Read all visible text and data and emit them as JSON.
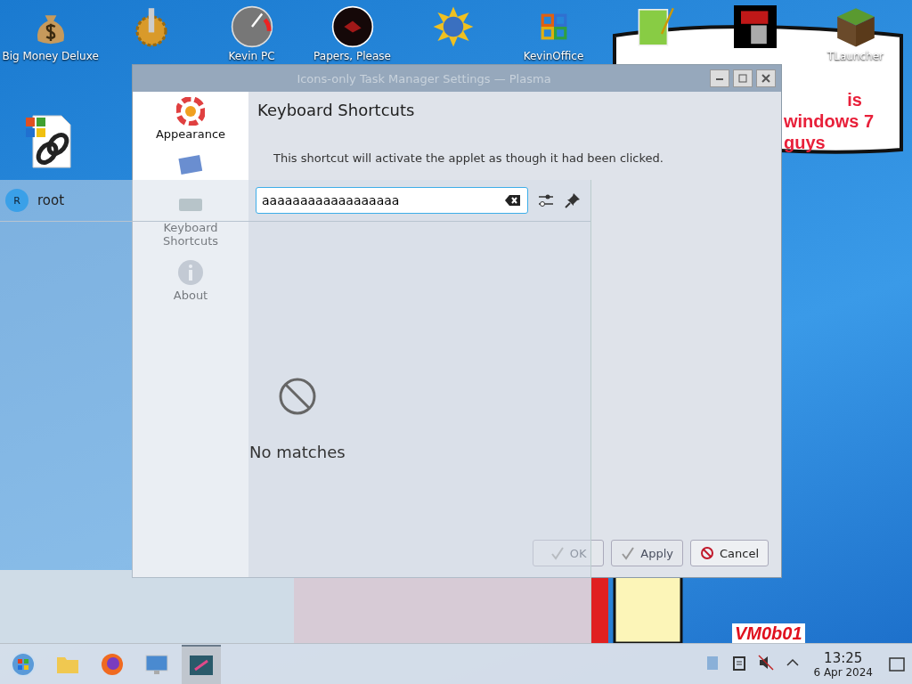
{
  "desktop": {
    "icons": [
      {
        "kind": "money",
        "label": "Big Money Deluxe"
      },
      {
        "kind": "gear"
      },
      {
        "kind": "gauge",
        "label": "Kevin PC"
      },
      {
        "kind": "disc",
        "label": "Papers, Please"
      },
      {
        "kind": "globe"
      },
      {
        "kind": "office",
        "label": "KevinOffice"
      },
      {
        "kind": "notepad"
      },
      {
        "kind": "mp"
      },
      {
        "kind": "cube",
        "label": "TLauncher"
      }
    ],
    "second_row": [
      {
        "kind": "shortcut"
      }
    ],
    "sticker": {
      "lines": [
        "is",
        "windows 7 guys"
      ]
    },
    "corner_text": "VM0b01"
  },
  "window": {
    "title": "Icons-only Task Manager Settings — Plasma",
    "sidebar": [
      {
        "kind": "appearance",
        "label": "Appearance"
      },
      {
        "kind": "behavior"
      },
      {
        "kind": "keyboard",
        "label": "Keyboard Shortcuts"
      },
      {
        "kind": "about",
        "label": "About"
      }
    ],
    "heading": "Keyboard Shortcuts",
    "description": "This shortcut will activate the applet as though it had been clicked.",
    "buttons": [
      {
        "kind": "ok",
        "label": "OK",
        "disabled": true
      },
      {
        "kind": "ok",
        "label": "Apply",
        "disabled": true
      },
      {
        "kind": "cancel",
        "label": "Cancel",
        "disabled": false
      }
    ]
  },
  "launcher": {
    "avatar": "R",
    "user": "root",
    "search": {
      "value": "aaaaaaaaaaaaaaaaaa"
    },
    "message": "No matches"
  },
  "taskbar": {
    "apps": [
      {
        "kind": "start",
        "active": false
      },
      {
        "kind": "folder",
        "active": false
      },
      {
        "kind": "firefox",
        "active": false
      },
      {
        "kind": "settings",
        "active": false
      },
      {
        "kind": "taskmanager",
        "active": true
      }
    ],
    "tray": [
      {
        "kind": "clipboard"
      },
      {
        "kind": "notes"
      },
      {
        "kind": "muted"
      },
      {
        "kind": "expand"
      }
    ],
    "time": "13:25",
    "date": "6 Apr 2024"
  }
}
